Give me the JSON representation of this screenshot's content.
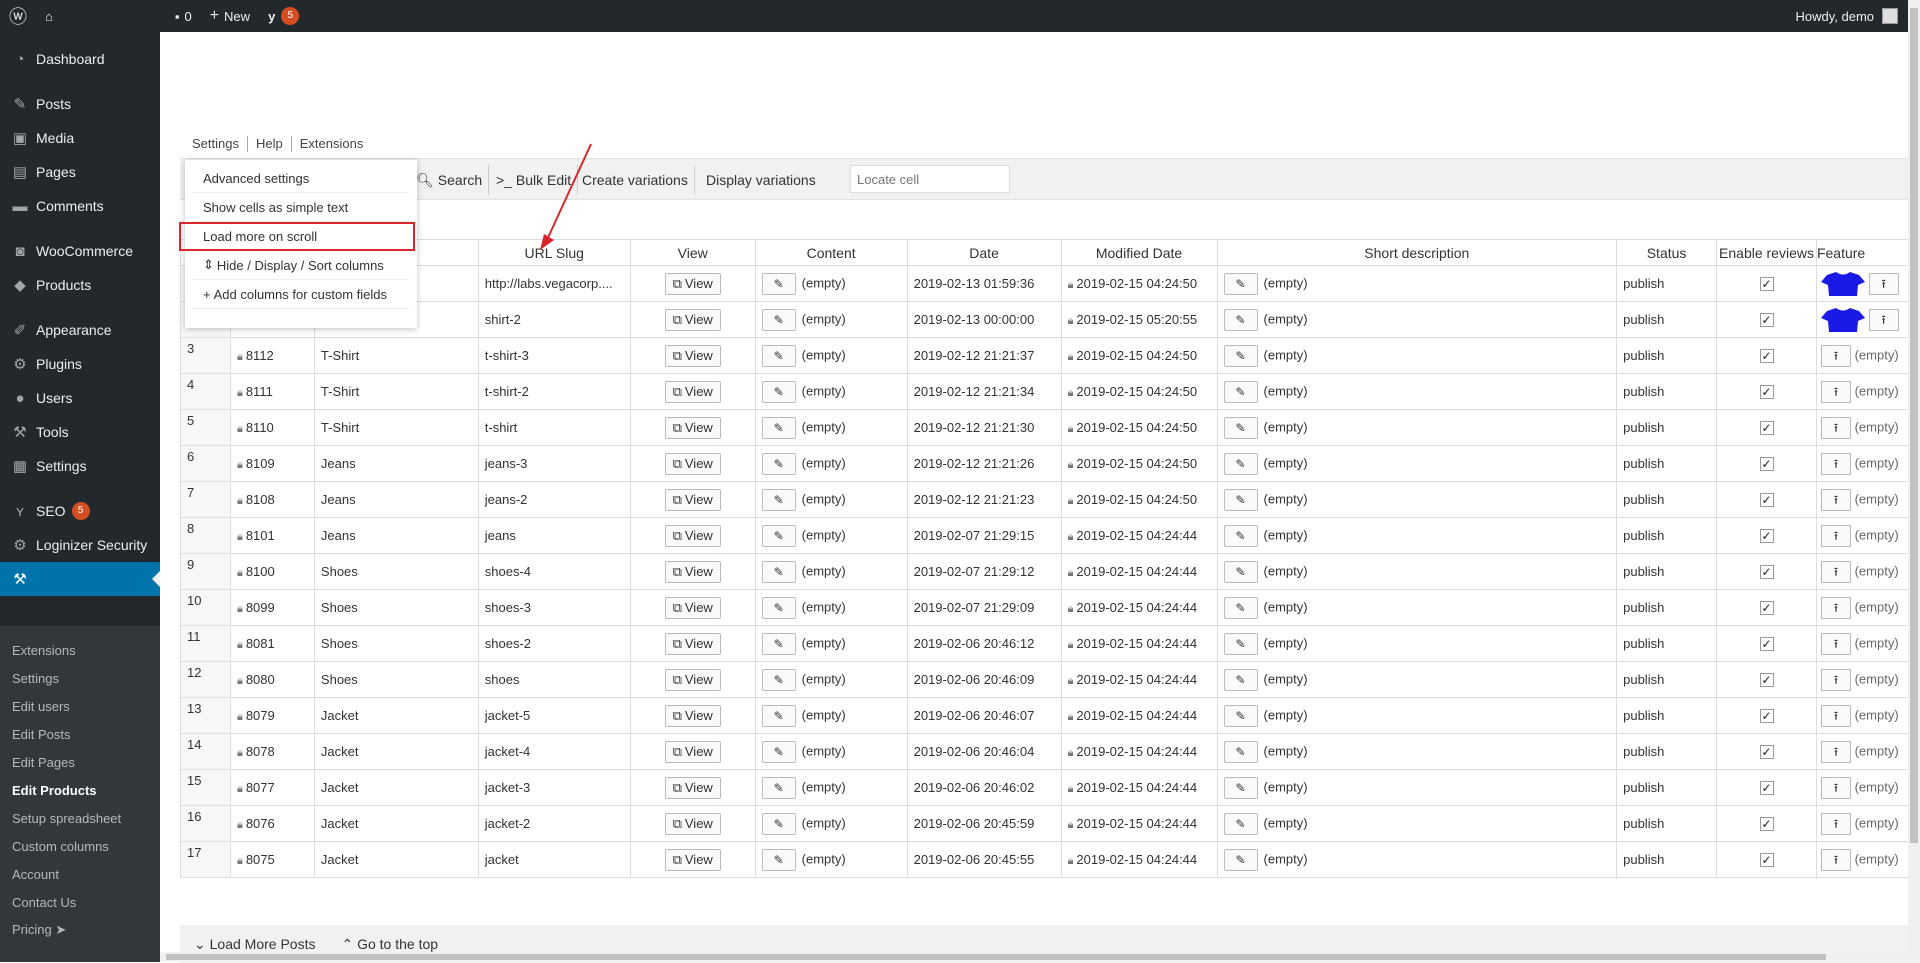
{
  "adminbar": {
    "comments_count": "0",
    "new_label": "New",
    "yoast_badge": "5",
    "howdy": "Howdy, demo"
  },
  "sidebar": {
    "items": [
      {
        "label": "Dashboard",
        "icon": "dashboard-icon"
      },
      {
        "label": "Posts",
        "icon": "pin-icon"
      },
      {
        "label": "Media",
        "icon": "media-icon"
      },
      {
        "label": "Pages",
        "icon": "pages-icon"
      },
      {
        "label": "Comments",
        "icon": "comment-icon"
      },
      {
        "label": "WooCommerce",
        "icon": "woo-icon"
      },
      {
        "label": "Products",
        "icon": "box-icon"
      },
      {
        "label": "Appearance",
        "icon": "brush-icon"
      },
      {
        "label": "Plugins",
        "icon": "plugin-icon"
      },
      {
        "label": "Users",
        "icon": "user-icon"
      },
      {
        "label": "Tools",
        "icon": "wrench-icon"
      },
      {
        "label": "Settings",
        "icon": "sliders-icon"
      },
      {
        "label": "SEO",
        "icon": "yoast-icon",
        "badge": "5"
      },
      {
        "label": "Loginizer Security",
        "icon": "gear-icon"
      }
    ],
    "submenu": [
      "Extensions",
      "Settings",
      "Edit users",
      "Edit Posts",
      "Edit Pages",
      "Edit Products",
      "Setup spreadsheet",
      "Custom columns",
      "Account",
      "Contact Us",
      "Pricing ➤"
    ]
  },
  "topmenu": [
    "Settings",
    "Help",
    "Extensions"
  ],
  "dropdown": [
    "Advanced settings",
    "Show cells as simple text",
    "Load more on scroll",
    "Hide / Display / Sort columns",
    "Add columns for custom fields"
  ],
  "toolbar": {
    "search": "Search",
    "bulk_edit": ">_ Bulk Edit",
    "create_variations": "Create variations",
    "display_variations": "Display variations",
    "locate_placeholder": "Locate cell"
  },
  "columns": [
    "URL Slug",
    "View",
    "Content",
    "Date",
    "Modified Date",
    "Short description",
    "Status",
    "Enable reviews",
    "Feature"
  ],
  "view_label": "View",
  "empty_label": "(empty)",
  "rows": [
    {
      "n": "",
      "id": "",
      "title": "",
      "slug": "http://labs.vegacorp....",
      "date": "2019-02-13 01:59:36",
      "mod": "2019-02-15 04:24:50",
      "status": "publish",
      "img": true
    },
    {
      "n": "",
      "id": "",
      "title": "",
      "slug": "shirt-2",
      "date": "2019-02-13 00:00:00",
      "mod": "2019-02-15 05:20:55",
      "status": "publish",
      "img": true
    },
    {
      "n": "3",
      "id": "8112",
      "title": "T-Shirt",
      "slug": "t-shirt-3",
      "date": "2019-02-12 21:21:37",
      "mod": "2019-02-15 04:24:50",
      "status": "publish"
    },
    {
      "n": "4",
      "id": "8111",
      "title": "T-Shirt",
      "slug": "t-shirt-2",
      "date": "2019-02-12 21:21:34",
      "mod": "2019-02-15 04:24:50",
      "status": "publish"
    },
    {
      "n": "5",
      "id": "8110",
      "title": "T-Shirt",
      "slug": "t-shirt",
      "date": "2019-02-12 21:21:30",
      "mod": "2019-02-15 04:24:50",
      "status": "publish"
    },
    {
      "n": "6",
      "id": "8109",
      "title": "Jeans",
      "slug": "jeans-3",
      "date": "2019-02-12 21:21:26",
      "mod": "2019-02-15 04:24:50",
      "status": "publish"
    },
    {
      "n": "7",
      "id": "8108",
      "title": "Jeans",
      "slug": "jeans-2",
      "date": "2019-02-12 21:21:23",
      "mod": "2019-02-15 04:24:50",
      "status": "publish"
    },
    {
      "n": "8",
      "id": "8101",
      "title": "Jeans",
      "slug": "jeans",
      "date": "2019-02-07 21:29:15",
      "mod": "2019-02-15 04:24:44",
      "status": "publish"
    },
    {
      "n": "9",
      "id": "8100",
      "title": "Shoes",
      "slug": "shoes-4",
      "date": "2019-02-07 21:29:12",
      "mod": "2019-02-15 04:24:44",
      "status": "publish"
    },
    {
      "n": "10",
      "id": "8099",
      "title": "Shoes",
      "slug": "shoes-3",
      "date": "2019-02-07 21:29:09",
      "mod": "2019-02-15 04:24:44",
      "status": "publish"
    },
    {
      "n": "11",
      "id": "8081",
      "title": "Shoes",
      "slug": "shoes-2",
      "date": "2019-02-06 20:46:12",
      "mod": "2019-02-15 04:24:44",
      "status": "publish"
    },
    {
      "n": "12",
      "id": "8080",
      "title": "Shoes",
      "slug": "shoes",
      "date": "2019-02-06 20:46:09",
      "mod": "2019-02-15 04:24:44",
      "status": "publish"
    },
    {
      "n": "13",
      "id": "8079",
      "title": "Jacket",
      "slug": "jacket-5",
      "date": "2019-02-06 20:46:07",
      "mod": "2019-02-15 04:24:44",
      "status": "publish"
    },
    {
      "n": "14",
      "id": "8078",
      "title": "Jacket",
      "slug": "jacket-4",
      "date": "2019-02-06 20:46:04",
      "mod": "2019-02-15 04:24:44",
      "status": "publish"
    },
    {
      "n": "15",
      "id": "8077",
      "title": "Jacket",
      "slug": "jacket-3",
      "date": "2019-02-06 20:46:02",
      "mod": "2019-02-15 04:24:44",
      "status": "publish"
    },
    {
      "n": "16",
      "id": "8076",
      "title": "Jacket",
      "slug": "jacket-2",
      "date": "2019-02-06 20:45:59",
      "mod": "2019-02-15 04:24:44",
      "status": "publish"
    },
    {
      "n": "17",
      "id": "8075",
      "title": "Jacket",
      "slug": "jacket",
      "date": "2019-02-06 20:45:55",
      "mod": "2019-02-15 04:24:44",
      "status": "publish"
    }
  ],
  "footer": {
    "load_more": "Load More Posts",
    "go_top": "Go to the top"
  },
  "colors": {
    "accent": "#0073aa",
    "highlight": "#d9262a",
    "tshirt": "#1a1ae6"
  }
}
